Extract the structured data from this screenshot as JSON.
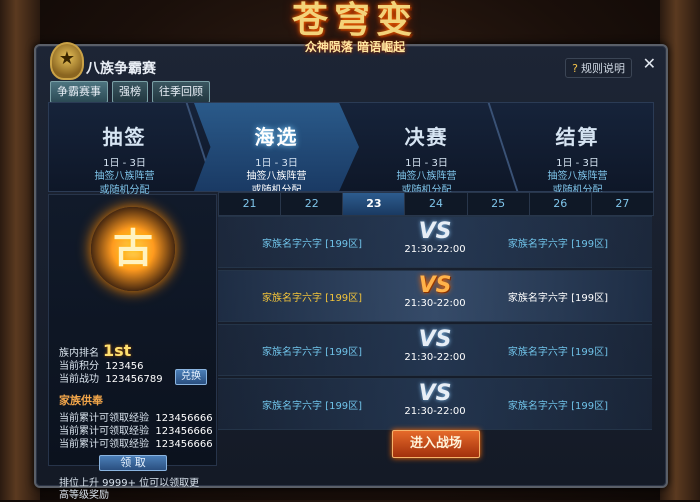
{
  "logo": {
    "main": "苍穹变",
    "sub": "众神陨落 暗语崛起"
  },
  "panel": {
    "title": "八族争霸赛",
    "rules_label": "规则说明",
    "close_label": "✕",
    "tabs": [
      "争霸赛事",
      "强榜",
      "往季回顾"
    ]
  },
  "phases": [
    {
      "title": "抽签",
      "date": "1日 - 3日",
      "desc1": "抽签八族阵营",
      "desc2": "或随机分配"
    },
    {
      "title": "海选",
      "date": "1日 - 3日",
      "desc1": "抽签八族阵营",
      "desc2": "或随机分配"
    },
    {
      "title": "决赛",
      "date": "1日 - 3日",
      "desc1": "抽签八族阵营",
      "desc2": "或随机分配"
    },
    {
      "title": "结算",
      "date": "1日 - 3日",
      "desc1": "抽签八族阵营",
      "desc2": "或随机分配"
    }
  ],
  "dates": [
    "21",
    "22",
    "23",
    "24",
    "25",
    "26",
    "27"
  ],
  "side": {
    "crest_glyph": "古",
    "rank_label": "族内排名",
    "rank_value": "1st",
    "points_label": "当前积分",
    "points_value": "123456",
    "power_label": "当前战功",
    "power_value": "123456789",
    "exchange_label": "兑换",
    "section_title": "家族供奉",
    "exp_lines": [
      {
        "label": "当前累计可领取经验",
        "value": "123456666"
      },
      {
        "label": "当前累计可领取经验",
        "value": "123456666"
      },
      {
        "label": "当前累计可领取经验",
        "value": "123456666"
      }
    ],
    "claim_label": "领 取",
    "note": "排位上升 9999+ 位可以领取更高等级奖励"
  },
  "matches": [
    {
      "left": "家族名字六字 [199区]",
      "vs": "VS",
      "time": "21:30-22:00",
      "right": "家族名字六字 [199区]"
    },
    {
      "left": "家族名字六字 [199区]",
      "vs": "VS",
      "time": "21:30-22:00",
      "right": "家族名字六字 [199区]"
    },
    {
      "left": "家族名字六字 [199区]",
      "vs": "VS",
      "time": "21:30-22:00",
      "right": "家族名字六字 [199区]"
    },
    {
      "left": "家族名字六字 [199区]",
      "vs": "VS",
      "time": "21:30-22:00",
      "right": "家族名字六字 [199区]"
    }
  ],
  "enter_label": "进入战场"
}
